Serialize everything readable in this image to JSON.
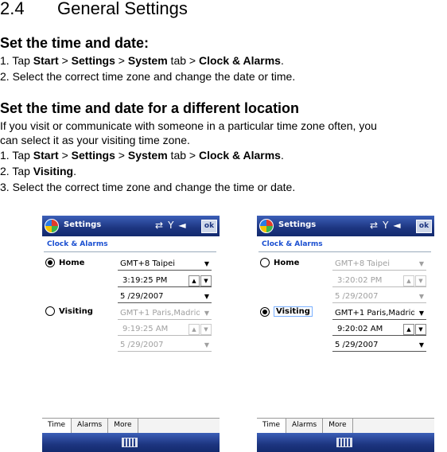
{
  "doc": {
    "section_number": "2.4",
    "section_title": "General Settings",
    "sub1": {
      "heading": "Set the time and date:",
      "step1": {
        "prefix": "1. Tap ",
        "b1": "Start",
        "s1": " > ",
        "b2": "Settings",
        "s2": " > ",
        "b3": "System",
        "s3": " tab > ",
        "b4": "Clock & Alarms",
        "s4": "."
      },
      "step2": "2. Select the correct time zone and change the date or time."
    },
    "sub2": {
      "heading": "Set the time and date for a different location",
      "intro_line1": "If you visit or communicate with someone in a particular time zone often, you",
      "intro_line2": "can select it as your visiting time zone.",
      "step1": {
        "prefix": "1. Tap ",
        "b1": "Start",
        "s1": " > ",
        "b2": "Settings",
        "s2": " > ",
        "b3": "System",
        "s3": " tab > ",
        "b4": "Clock & Alarms",
        "s4": "."
      },
      "step2": {
        "prefix": "2. Tap ",
        "b1": "Visiting",
        "s1": "."
      },
      "step3": "3. Select the correct time zone and change the time or date."
    }
  },
  "screens": [
    {
      "title": "Settings",
      "ok": "ok",
      "subtitle": "Clock & Alarms",
      "home_label": "Home",
      "home_tz": "GMT+8 Taipei",
      "home_time": "3:19:25 PM",
      "home_date": "5 /29/2007",
      "visiting_label": "Visiting",
      "visiting_tz": "GMT+1 Paris,Madrid",
      "visiting_time": "9:19:25 AM",
      "visiting_date": "5 /29/2007",
      "tabs": [
        "Time",
        "Alarms",
        "More"
      ]
    },
    {
      "title": "Settings",
      "ok": "ok",
      "subtitle": "Clock & Alarms",
      "home_label": "Home",
      "home_tz": "GMT+8 Taipei",
      "home_time": "3:20:02 PM",
      "home_date": "5 /29/2007",
      "visiting_label": "Visiting",
      "visiting_tz": "GMT+1 Paris,Madrid",
      "visiting_time": "9:20:02 AM",
      "visiting_date": "5 /29/2007",
      "tabs": [
        "Time",
        "Alarms",
        "More"
      ]
    }
  ]
}
